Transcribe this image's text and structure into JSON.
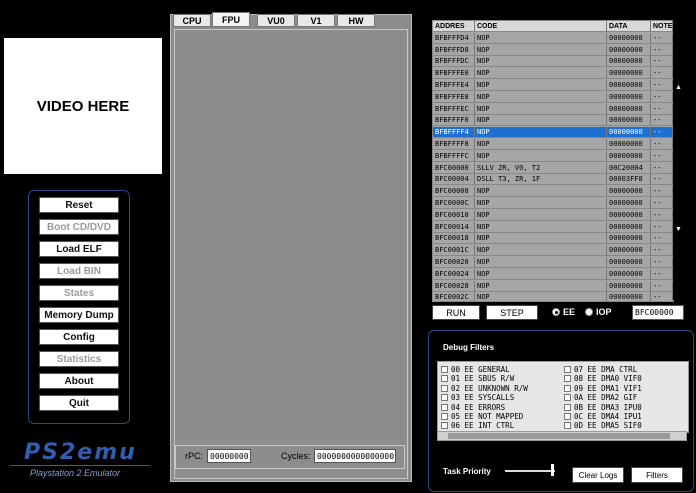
{
  "video": {
    "placeholder": "VIDEO HERE"
  },
  "left_buttons": [
    {
      "label": "Reset",
      "enabled": true
    },
    {
      "label": "Boot CD/DVD",
      "enabled": false
    },
    {
      "label": "Load ELF",
      "enabled": true
    },
    {
      "label": "Load BIN",
      "enabled": false
    },
    {
      "label": "States",
      "enabled": false
    },
    {
      "label": "Memory Dump",
      "enabled": true
    },
    {
      "label": "Config",
      "enabled": true
    },
    {
      "label": "Statistics",
      "enabled": false
    },
    {
      "label": "About",
      "enabled": true
    },
    {
      "label": "Quit",
      "enabled": true
    }
  ],
  "logo": {
    "title": "PS2emu",
    "subtitle": "Playstation 2 Emulator"
  },
  "tabs": [
    "CPU",
    "FPU",
    "VU0",
    "V1",
    "HW"
  ],
  "active_tab": "FPU",
  "status": {
    "rpc_label": "rPC:",
    "rpc_value": "00000000",
    "cycles_label": "Cycles:",
    "cycles_value": "0000000000000000"
  },
  "code_table": {
    "headers": [
      "ADDRES",
      "CODE",
      "DATA",
      "NOTE"
    ],
    "rows": [
      [
        "BFBFFFD4",
        "NOP",
        "00000000",
        "--"
      ],
      [
        "BFBFFFD8",
        "NOP",
        "00000000",
        "--"
      ],
      [
        "BFBFFFDC",
        "NOP",
        "00000000",
        "--"
      ],
      [
        "BFBFFFE0",
        "NOP",
        "00000000",
        "--"
      ],
      [
        "BFBFFFE4",
        "NOP",
        "00000000",
        "--"
      ],
      [
        "BFBFFFE8",
        "NOP",
        "00000000",
        "--"
      ],
      [
        "BFBFFFEC",
        "NOP",
        "00000000",
        "--"
      ],
      [
        "BFBFFFF0",
        "NOP",
        "00000000",
        "--"
      ],
      [
        "BFBFFFF4",
        "NOP",
        "00000000",
        "--"
      ],
      [
        "BFBFFFF8",
        "NOP",
        "00000000",
        "--"
      ],
      [
        "BFBFFFFC",
        "NOP",
        "00000000",
        "--"
      ],
      [
        "BFC00000",
        "SLLV ZR, V0, T2",
        "00C20004",
        "--"
      ],
      [
        "BFC00004",
        "DSLL T3, ZR, 1F",
        "00003FF8",
        "--"
      ],
      [
        "BFC00008",
        "NOP",
        "00000000",
        "--"
      ],
      [
        "BFC0000C",
        "NOP",
        "00000000",
        "--"
      ],
      [
        "BFC00010",
        "NOP",
        "00000000",
        "--"
      ],
      [
        "BFC00014",
        "NOP",
        "00000000",
        "--"
      ],
      [
        "BFC00018",
        "NOP",
        "00000000",
        "--"
      ],
      [
        "BFC0001C",
        "NOP",
        "00000000",
        "--"
      ],
      [
        "BFC00020",
        "NOP",
        "00000000",
        "--"
      ],
      [
        "BFC00024",
        "NOP",
        "00000000",
        "--"
      ],
      [
        "BFC00028",
        "NOP",
        "00000000",
        "--"
      ],
      [
        "BFC0002C",
        "NOP",
        "00000000",
        "--"
      ]
    ],
    "selected_row": 8
  },
  "controls": {
    "run": "RUN",
    "step": "STEP",
    "ee": "EE",
    "iop": "IOP",
    "selected": "EE",
    "address": "BFC00000"
  },
  "debug": {
    "title": "Debug Filters",
    "filters_left": [
      "00 EE GENERAL",
      "01 EE SBUS R/W",
      "02 EE UNKNOWN R/W",
      "03 EE SYSCALLS",
      "04 EE ERRORS",
      "05 EE NOT MAPPED",
      "06 EE INT CTRL"
    ],
    "filters_right": [
      "07 EE DMA CTRL",
      "08 EE DMA0 VIF0",
      "09 EE DMA1 VIF1",
      "0A EE DMA2 GIF",
      "0B EE DMA3 IPU0",
      "0C EE DMA4 IPU1",
      "0D EE DMA5 SIF0"
    ],
    "task_priority_label": "Task Priority",
    "clear_logs": "Clear Logs",
    "filters_button": "Filters"
  }
}
